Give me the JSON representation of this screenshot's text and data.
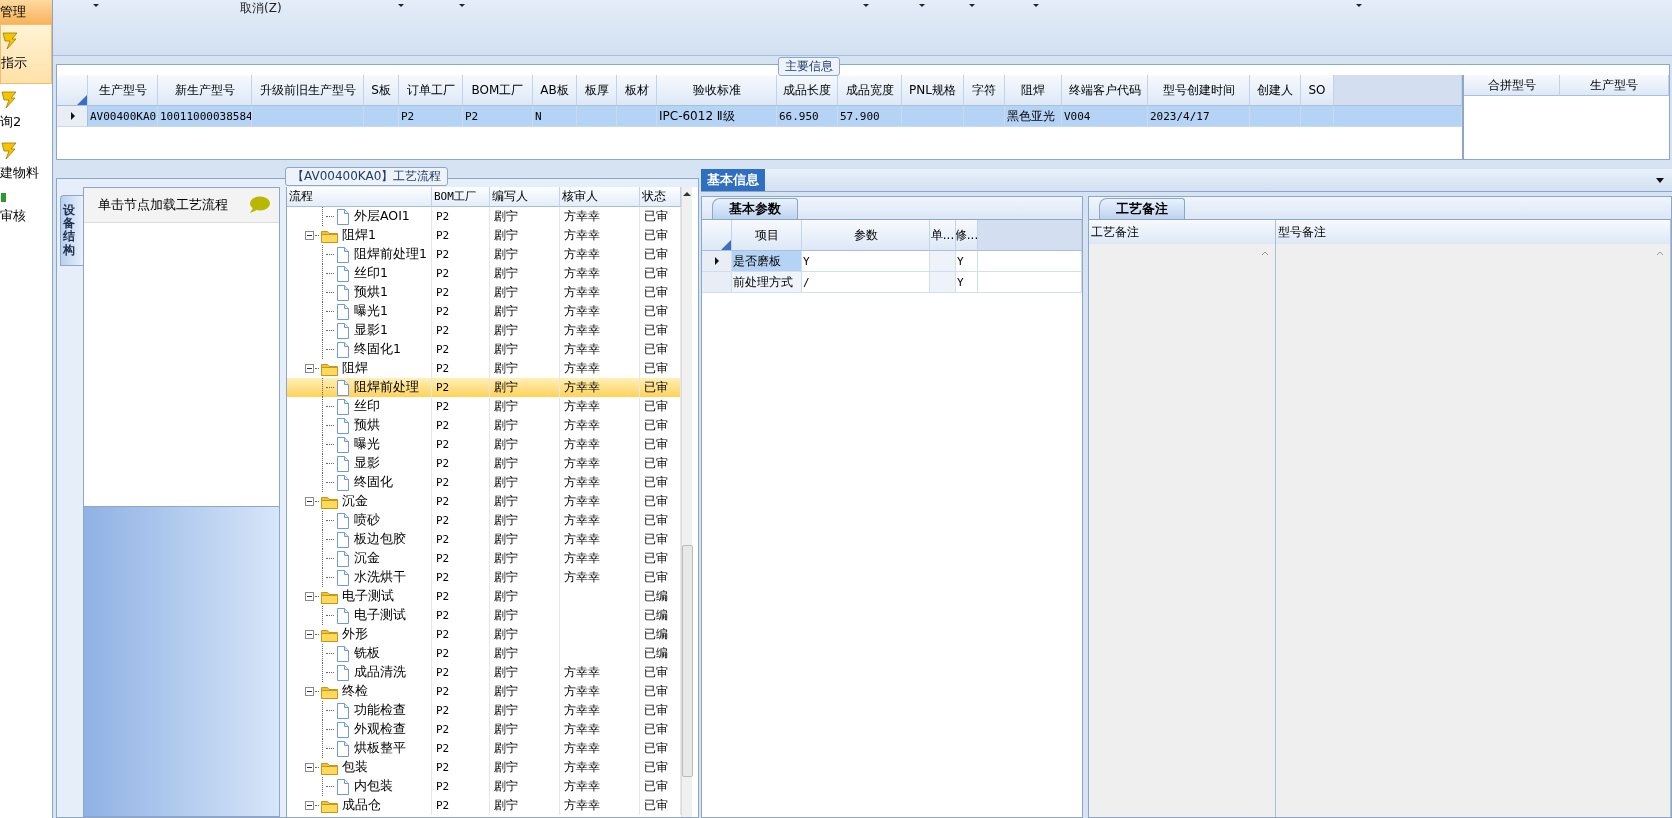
{
  "sidebar": {
    "title": "管理",
    "items": [
      {
        "label": "指示",
        "selected": true
      },
      {
        "label": "询2",
        "selected": false
      },
      {
        "label": "建物料",
        "selected": false
      },
      {
        "label": "审核",
        "selected": false
      }
    ]
  },
  "toolbar": {
    "items": [
      {
        "kind": "dropdown"
      },
      {
        "kind": "button",
        "label": "取消(Z)"
      },
      {
        "kind": "dropdown"
      },
      {
        "kind": "dropdown"
      },
      {
        "kind": "dropdown"
      },
      {
        "kind": "dropdown"
      },
      {
        "kind": "dropdown"
      },
      {
        "kind": "dropdown"
      },
      {
        "kind": "dropdown"
      }
    ]
  },
  "main_info": {
    "title": "主要信息",
    "table": {
      "columns": [
        "生产型号",
        "新生产型号",
        "升级前旧生产型号",
        "S板",
        "订单工厂",
        "BOM工厂",
        "AB板",
        "板厚",
        "板材",
        "验收标准",
        "成品长度",
        "成品宽度",
        "PNL规格",
        "字符",
        "阻焊",
        "终端客户代码",
        "型号创建时间",
        "创建人",
        "SO"
      ],
      "rows": [
        {
          "selected": true,
          "cells": [
            "AV00400KA0",
            "10011000038584",
            null,
            null,
            "P2",
            "P2",
            "N",
            null,
            null,
            "IPC-6012 Ⅱ级",
            "66.950",
            "57.900",
            null,
            null,
            "黑色亚光",
            "V004",
            "2023/4/17",
            null,
            null
          ]
        }
      ]
    },
    "side_table": {
      "columns": [
        "合拼型号",
        "生产型号"
      ]
    }
  },
  "flow": {
    "title": "【AV00400KA0】工艺流程",
    "side_tab": {
      "label": "设备结构",
      "selected": true
    },
    "hint": "单击节点加载工艺流程",
    "columns": [
      "流程",
      "BOM工厂",
      "编写人",
      "核审人",
      "状态"
    ],
    "tree": [
      {
        "kind": "continued",
        "children": [
          {
            "kind": "file",
            "name": "外层AOI1",
            "bom": "P2",
            "writer": "剧宁",
            "reviewer": "方幸幸",
            "status": "已审",
            "selected": false
          }
        ]
      },
      {
        "kind": "folder",
        "name": "阻焊1",
        "bom": "P2",
        "writer": "剧宁",
        "reviewer": "方幸幸",
        "status": "已审",
        "selected": false,
        "expanded": true,
        "children": [
          {
            "kind": "file",
            "name": "阻焊前处理1",
            "bom": "P2",
            "writer": "剧宁",
            "reviewer": "方幸幸",
            "status": "已审",
            "selected": false
          },
          {
            "kind": "file",
            "name": "丝印1",
            "bom": "P2",
            "writer": "剧宁",
            "reviewer": "方幸幸",
            "status": "已审",
            "selected": false
          },
          {
            "kind": "file",
            "name": "预烘1",
            "bom": "P2",
            "writer": "剧宁",
            "reviewer": "方幸幸",
            "status": "已审",
            "selected": false
          },
          {
            "kind": "file",
            "name": "曝光1",
            "bom": "P2",
            "writer": "剧宁",
            "reviewer": "方幸幸",
            "status": "已审",
            "selected": false
          },
          {
            "kind": "file",
            "name": "显影1",
            "bom": "P2",
            "writer": "剧宁",
            "reviewer": "方幸幸",
            "status": "已审",
            "selected": false
          },
          {
            "kind": "file",
            "name": "终固化1",
            "bom": "P2",
            "writer": "剧宁",
            "reviewer": "方幸幸",
            "status": "已审",
            "selected": false
          }
        ]
      },
      {
        "kind": "folder",
        "name": "阻焊",
        "bom": "P2",
        "writer": "剧宁",
        "reviewer": "方幸幸",
        "status": "已审",
        "selected": false,
        "expanded": true,
        "children": [
          {
            "kind": "file",
            "name": "阻焊前处理",
            "bom": "P2",
            "writer": "剧宁",
            "reviewer": "方幸幸",
            "status": "已审",
            "selected": true
          },
          {
            "kind": "file",
            "name": "丝印",
            "bom": "P2",
            "writer": "剧宁",
            "reviewer": "方幸幸",
            "status": "已审",
            "selected": false
          },
          {
            "kind": "file",
            "name": "预烘",
            "bom": "P2",
            "writer": "剧宁",
            "reviewer": "方幸幸",
            "status": "已审",
            "selected": false
          },
          {
            "kind": "file",
            "name": "曝光",
            "bom": "P2",
            "writer": "剧宁",
            "reviewer": "方幸幸",
            "status": "已审",
            "selected": false
          },
          {
            "kind": "file",
            "name": "显影",
            "bom": "P2",
            "writer": "剧宁",
            "reviewer": "方幸幸",
            "status": "已审",
            "selected": false
          },
          {
            "kind": "file",
            "name": "终固化",
            "bom": "P2",
            "writer": "剧宁",
            "reviewer": "方幸幸",
            "status": "已审",
            "selected": false
          }
        ]
      },
      {
        "kind": "folder",
        "name": "沉金",
        "bom": "P2",
        "writer": "剧宁",
        "reviewer": "方幸幸",
        "status": "已审",
        "selected": false,
        "expanded": true,
        "children": [
          {
            "kind": "file",
            "name": "喷砂",
            "bom": "P2",
            "writer": "剧宁",
            "reviewer": "方幸幸",
            "status": "已审",
            "selected": false
          },
          {
            "kind": "file",
            "name": "板边包胶",
            "bom": "P2",
            "writer": "剧宁",
            "reviewer": "方幸幸",
            "status": "已审",
            "selected": false
          },
          {
            "kind": "file",
            "name": "沉金",
            "bom": "P2",
            "writer": "剧宁",
            "reviewer": "方幸幸",
            "status": "已审",
            "selected": false
          },
          {
            "kind": "file",
            "name": "水洗烘干",
            "bom": "P2",
            "writer": "剧宁",
            "reviewer": "方幸幸",
            "status": "已审",
            "selected": false
          }
        ]
      },
      {
        "kind": "folder",
        "name": "电子测试",
        "bom": "P2",
        "writer": "剧宁",
        "status": "已编",
        "selected": false,
        "expanded": true,
        "children": [
          {
            "kind": "file",
            "name": "电子测试",
            "bom": "P2",
            "writer": "剧宁",
            "status": "已编",
            "selected": false
          }
        ]
      },
      {
        "kind": "folder",
        "name": "外形",
        "bom": "P2",
        "writer": "剧宁",
        "status": "已编",
        "selected": false,
        "expanded": true,
        "children": [
          {
            "kind": "file",
            "name": "铣板",
            "bom": "P2",
            "writer": "剧宁",
            "status": "已编",
            "selected": false
          },
          {
            "kind": "file",
            "name": "成品清洗",
            "bom": "P2",
            "writer": "剧宁",
            "reviewer": "方幸幸",
            "status": "已审",
            "selected": false
          }
        ]
      },
      {
        "kind": "folder",
        "name": "终检",
        "bom": "P2",
        "writer": "剧宁",
        "reviewer": "方幸幸",
        "status": "已审",
        "selected": false,
        "expanded": true,
        "children": [
          {
            "kind": "file",
            "name": "功能检查",
            "bom": "P2",
            "writer": "剧宁",
            "reviewer": "方幸幸",
            "status": "已审",
            "selected": false
          },
          {
            "kind": "file",
            "name": "外观检查",
            "bom": "P2",
            "writer": "剧宁",
            "reviewer": "方幸幸",
            "status": "已审",
            "selected": false
          },
          {
            "kind": "file",
            "name": "烘板整平",
            "bom": "P2",
            "writer": "剧宁",
            "reviewer": "方幸幸",
            "status": "已审",
            "selected": false
          }
        ]
      },
      {
        "kind": "folder",
        "name": "包装",
        "bom": "P2",
        "writer": "剧宁",
        "reviewer": "方幸幸",
        "status": "已审",
        "selected": false,
        "expanded": true,
        "children": [
          {
            "kind": "file",
            "name": "内包装",
            "bom": "P2",
            "writer": "剧宁",
            "reviewer": "方幸幸",
            "status": "已审",
            "selected": false
          }
        ]
      },
      {
        "kind": "folder",
        "name": "成品仓",
        "bom": "P2",
        "writer": "剧宁",
        "reviewer": "方幸幸",
        "status": "已审",
        "selected": false,
        "expanded": true
      }
    ]
  },
  "basic_info": {
    "tab": {
      "label": "基本信息",
      "selected": true
    },
    "params": {
      "tab": {
        "label": "基本参数",
        "selected": true
      },
      "columns": [
        "项目",
        "参数",
        "单...",
        "修..."
      ],
      "rows": [
        {
          "selected": true,
          "cells": [
            "是否磨板",
            "Y",
            null,
            "Y"
          ]
        },
        {
          "selected": false,
          "cells": [
            "前处理方式",
            "/",
            null,
            "Y"
          ]
        }
      ]
    },
    "notes": {
      "tab": {
        "label": "工艺备注",
        "selected": true
      },
      "columns": [
        "工艺备注",
        "型号备注"
      ]
    }
  }
}
